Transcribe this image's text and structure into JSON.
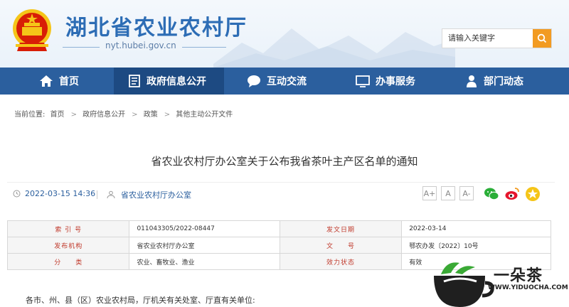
{
  "header": {
    "site_name": "湖北省农业农村厅",
    "site_url": "nyt.hubei.gov.cn",
    "search_placeholder": "请输入关键字"
  },
  "nav": {
    "items": [
      {
        "label": "首页",
        "icon": "home-icon"
      },
      {
        "label": "政府信息公开",
        "icon": "document-icon",
        "active": true
      },
      {
        "label": "互动交流",
        "icon": "chat-icon"
      },
      {
        "label": "办事服务",
        "icon": "monitor-icon"
      },
      {
        "label": "部门动态",
        "icon": "person-icon"
      }
    ]
  },
  "breadcrumb": {
    "prefix": "当前位置:",
    "items": [
      "首页",
      "政府信息公开",
      "政策",
      "其他主动公开文件"
    ]
  },
  "article": {
    "title": "省农业农村厅办公室关于公布我省茶叶主产区名单的通知",
    "date": "2022-03-15 14:36",
    "source": "省农业农村厅办公室",
    "font_sizes": [
      "A+",
      "A",
      "A-"
    ],
    "share_icons": [
      "wechat-icon",
      "weibo-icon",
      "favorite-icon"
    ],
    "body_first_line": "各市、州、县（区）农业农村局，厅机关有关处室、厅直有关单位:"
  },
  "info_table": {
    "rows": [
      [
        {
          "k": "索 引 号",
          "v": "011043305/2022-08447"
        },
        {
          "k": "发文日期",
          "v": "2022-03-14"
        }
      ],
      [
        {
          "k": "发布机构",
          "v": "省农业农村厅办公室"
        },
        {
          "k": "文　　号",
          "v": "鄂农办发〔2022〕10号"
        }
      ],
      [
        {
          "k": "分　　类",
          "v": "农业、畜牧业、渔业"
        },
        {
          "k": "效力状态",
          "v": "有效"
        }
      ]
    ]
  },
  "watermark": {
    "name": "一朵茶",
    "url": "WWW.YIDUOCHA.COM"
  },
  "colors": {
    "nav_bg": "#2b5f9e",
    "nav_active": "#1d4a82",
    "search_button": "#f29b22",
    "link": "#2b5f9e",
    "table_key": "#c0392b"
  }
}
